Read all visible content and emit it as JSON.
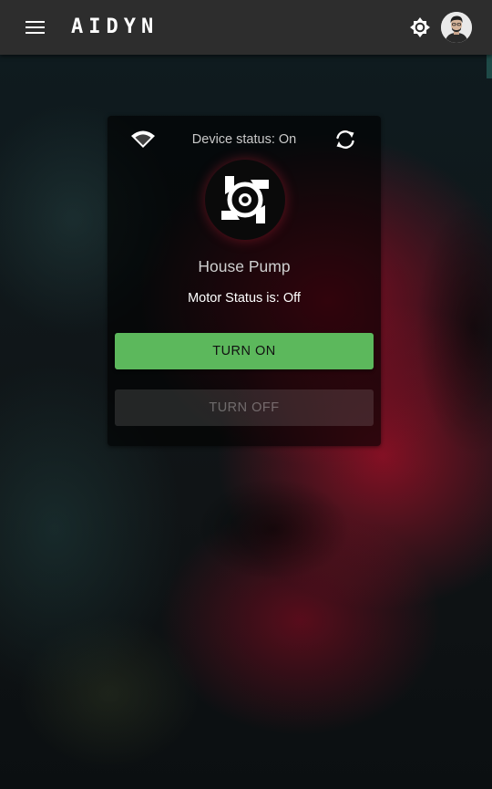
{
  "app": {
    "brand": "AIDYN"
  },
  "card": {
    "device_status": "Device status: On",
    "device_name": "House Pump",
    "motor_status": "Motor Status is: Off",
    "turn_on_label": "TURN ON",
    "turn_off_label": "TURN OFF"
  },
  "icons": {
    "menu": "menu-icon",
    "theme": "brightness-icon",
    "avatar": "user-avatar",
    "wifi": "wifi-icon",
    "sync": "sync-icon",
    "logo": "device-logo"
  },
  "colors": {
    "topbar": "#2d2d2d",
    "accent_green": "#5cb85c",
    "background_red": "#96102a"
  }
}
